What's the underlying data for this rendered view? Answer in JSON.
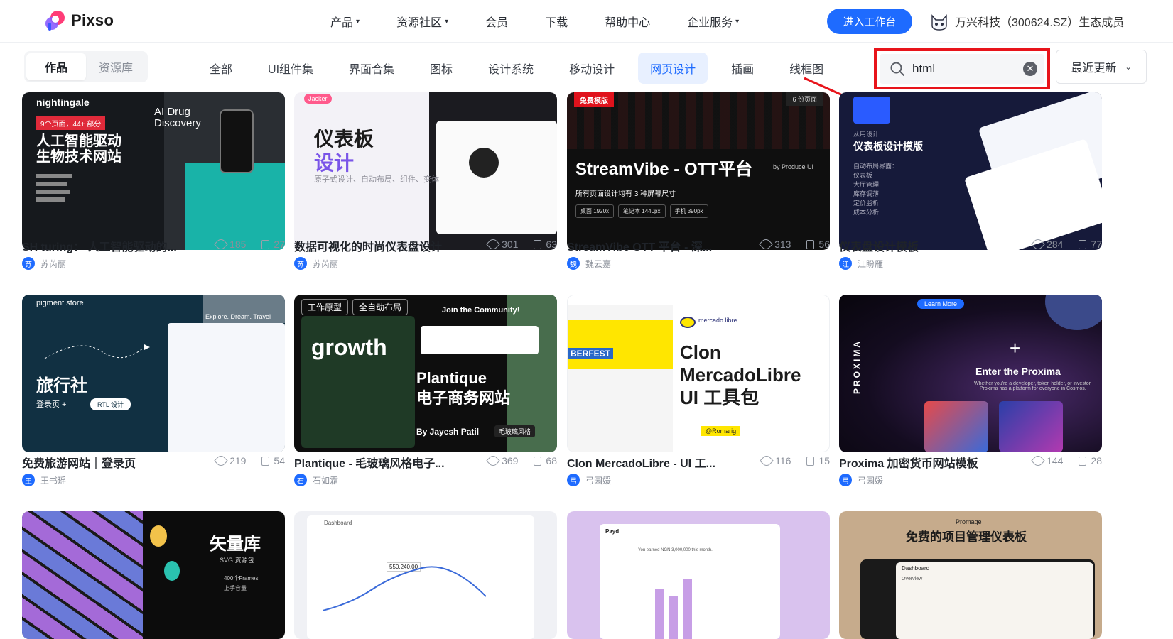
{
  "header": {
    "brand": "Pixso",
    "nav": [
      {
        "label": "产品",
        "has_dropdown": true
      },
      {
        "label": "资源社区",
        "has_dropdown": true
      },
      {
        "label": "会员",
        "has_dropdown": false
      },
      {
        "label": "下载",
        "has_dropdown": false
      },
      {
        "label": "帮助中心",
        "has_dropdown": false
      },
      {
        "label": "企业服务",
        "has_dropdown": true
      }
    ],
    "cta_label": "进入工作台",
    "partner_text": "万兴科技（300624.SZ）生态成员"
  },
  "filters": {
    "segments": [
      {
        "label": "作品",
        "active": true
      },
      {
        "label": "资源库",
        "active": false
      }
    ],
    "categories": [
      {
        "label": "全部",
        "active": false
      },
      {
        "label": "UI组件集",
        "active": false
      },
      {
        "label": "界面合集",
        "active": false
      },
      {
        "label": "图标",
        "active": false
      },
      {
        "label": "设计系统",
        "active": false
      },
      {
        "label": "移动设计",
        "active": false
      },
      {
        "label": "网页设计",
        "active": true
      },
      {
        "label": "插画",
        "active": false
      },
      {
        "label": "线框图",
        "active": false
      }
    ],
    "search_value": "html",
    "sort_label": "最近更新"
  },
  "cards": [
    {
      "title": "SH turing： 人工智能驱动的...",
      "views": "185",
      "pages": "27",
      "author": "苏芮丽",
      "avatar": "苏",
      "thumb": {
        "brand": "nightingale",
        "badge": "9个页面，44+ 部分",
        "headline": "人工智能驱动\n生物技术网站",
        "sub": "AI Drug\nDiscovery"
      }
    },
    {
      "title": "数据可视化的时尚仪表盘设计",
      "views": "301",
      "pages": "63",
      "author": "苏芮丽",
      "avatar": "苏",
      "thumb": {
        "headline1": "仪表板",
        "headline2": "设计",
        "sub": "原子式设计、自动布局、组件、变体",
        "tag": "Jacker"
      }
    },
    {
      "title": "StreamVibe OTT 平台 - 深...",
      "views": "313",
      "pages": "56",
      "author": "魏云嘉",
      "avatar": "魏",
      "thumb": {
        "badge": "免费模版",
        "pages_badge": "6 份页面",
        "headline": "StreamVibe - OTT平台",
        "by": "by Produce UI",
        "sub": "所有页面设计均有 3 种屏幕尺寸",
        "chips": [
          "桌面 1920x",
          "笔记本 1440px",
          "手机 390px"
        ]
      }
    },
    {
      "title": "仪表盘设计模板",
      "views": "284",
      "pages": "77",
      "author": "江盼雁",
      "avatar": "江",
      "thumb": {
        "kicker": "从用设计",
        "headline": "仪表板设计模版",
        "list": [
          "自动布局界面：",
          "仪表板",
          "大厅管理",
          "库存调薄",
          "定价监析",
          "成本分析"
        ]
      }
    },
    {
      "title": "免费旅游网站｜登录页",
      "views": "219",
      "pages": "54",
      "author": "王书瑶",
      "avatar": "王",
      "thumb": {
        "brand": "pigment store",
        "headline": "旅行社",
        "sub": "登录页 +",
        "chip": "RTL 设计",
        "tag": "Explore. Dream. Travel"
      }
    },
    {
      "title": "Plantique - 毛玻璃风格电子...",
      "views": "369",
      "pages": "68",
      "author": "石如霜",
      "avatar": "石",
      "thumb": {
        "chips": [
          "工作原型",
          "全自动布局"
        ],
        "word": "growth",
        "community": "Join the Community!",
        "headline": "Plantique\n电子商务网站",
        "by": "By Jayesh Patil",
        "style": "毛玻璃风格"
      }
    },
    {
      "title": "Clon MercadoLibre - UI 工...",
      "views": "116",
      "pages": "15",
      "author": "弓园媛",
      "avatar": "弓",
      "thumb": {
        "logo": "mercado libre",
        "headline": "Clon\nMercadoLibre\nUI 工具包",
        "promo": "BERFEST",
        "tag": "@Romarig"
      }
    },
    {
      "title": "Proxima 加密货币网站模板",
      "views": "144",
      "pages": "28",
      "author": "弓园媛",
      "avatar": "弓",
      "thumb": {
        "pill": "Learn More",
        "side": "PROXIMA",
        "headline": "Enter the Proxima",
        "sub": "Whether you're a developer, token holder, or investor,\nProxima has a platform for everyone in Cosmos."
      }
    },
    {
      "title": "",
      "views": "",
      "pages": "",
      "author": "",
      "avatar": "",
      "thumb": {
        "headline": "矢量库",
        "sub": "SVG 资源包",
        "list": [
          "400个Frames",
          "上手容量"
        ]
      }
    },
    {
      "title": "",
      "views": "",
      "pages": "",
      "author": "",
      "avatar": "",
      "thumb": {
        "label": "Dashboard",
        "value": "550,240.00"
      }
    },
    {
      "title": "",
      "views": "",
      "pages": "",
      "author": "",
      "avatar": "",
      "thumb": {
        "brand": "Payd",
        "sub": "You earned NGN 3,000,000 this month."
      }
    },
    {
      "title": "",
      "views": "",
      "pages": "",
      "author": "",
      "avatar": "",
      "thumb": {
        "brand": "Promage",
        "headline": "免费的项目管理仪表板",
        "label": "Dashboard",
        "sub": "Overview"
      }
    }
  ]
}
